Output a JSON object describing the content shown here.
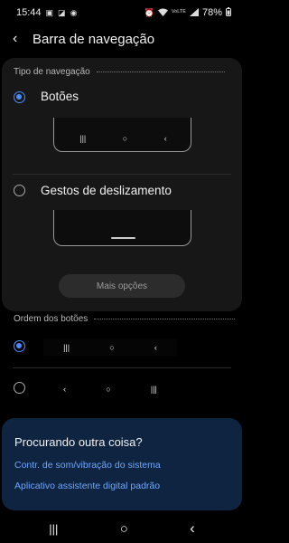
{
  "status_bar": {
    "time": "15:44",
    "left_icons": [
      "gallery-icon",
      "photo-icon",
      "shazam-icon"
    ],
    "right_icons": [
      "alarm-icon",
      "wifi-icon",
      "volte-icon",
      "signal-icon"
    ],
    "volte_text": "VoLTE",
    "battery": "78%"
  },
  "header": {
    "back_icon": "‹",
    "title": "Barra de navegação"
  },
  "navigation_type": {
    "section_title": "Tipo de navegação",
    "options": [
      {
        "label": "Botões",
        "selected": true,
        "preview_icons": [
          "|||",
          "○",
          "‹"
        ]
      },
      {
        "label": "Gestos de deslizamento",
        "selected": false
      }
    ],
    "more_options_label": "Mais opções"
  },
  "button_order": {
    "section_title": "Ordem dos botões",
    "options": [
      {
        "selected": true,
        "icons": [
          "|||",
          "○",
          "‹"
        ]
      },
      {
        "selected": false,
        "icons": [
          "‹",
          "○",
          "|||"
        ]
      }
    ]
  },
  "looking_card": {
    "title": "Procurando outra coisa?",
    "links": [
      "Contr. de som/vibração do sistema",
      "Aplicativo assistente digital padrão"
    ]
  },
  "nav_bar": {
    "recents": "|||",
    "home": "○",
    "back": "‹"
  },
  "colors": {
    "accent": "#4b8cff",
    "link": "#6ea6ff",
    "card": "#171717",
    "info_card": "#0f2440"
  }
}
